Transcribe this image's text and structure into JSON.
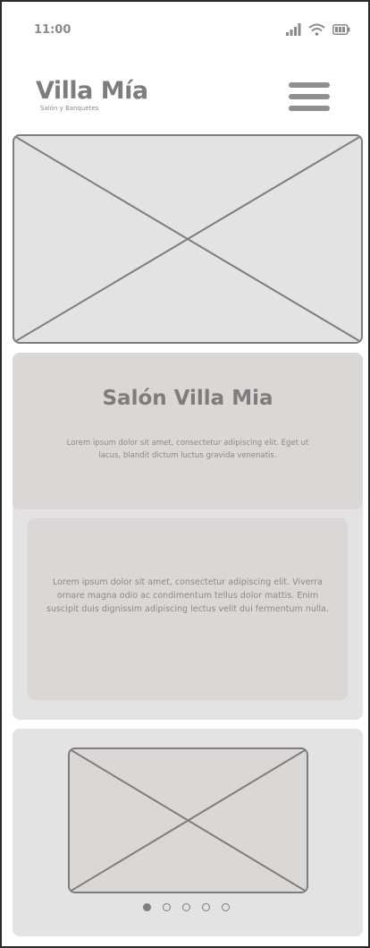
{
  "status_bar": {
    "time": "11:00",
    "icons": [
      "signal-icon",
      "wifi-icon",
      "battery-icon"
    ]
  },
  "header": {
    "title": "Villa Mía",
    "subtitle": "Salón y Banquetes",
    "menu_icon": "hamburger-menu-icon"
  },
  "hero": {
    "image_placeholder": "image-placeholder-icon"
  },
  "info": {
    "title": "Salón Villa Mia",
    "lead": "Lorem ipsum dolor sit amet, consectetur adipiscing elit. Eget ut lacus, blandit dictum luctus gravida venenatis.",
    "body": "Lorem ipsum dolor sit amet, consectetur adipiscing elit. Viverra ornare magna odio ac condimentum tellus dolor mattis. Enim suscipit duis dignissim adipiscing lectus velit dui fermentum nulla."
  },
  "carousel": {
    "image_placeholder": "image-placeholder-icon",
    "slide_count": 5,
    "active_slide": 1
  },
  "colors": {
    "placeholder_gray": "#e3e3e3",
    "placeholder_warm": "#dbd7d6",
    "stroke": "#7d7d7d",
    "text": "#8a8a8a"
  }
}
